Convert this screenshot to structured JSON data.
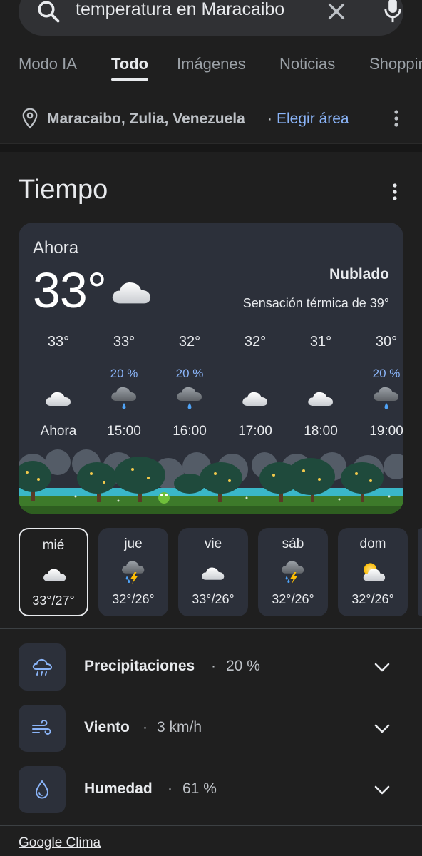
{
  "search": {
    "query": "temperatura en Maracaibo"
  },
  "tabs": [
    {
      "label": "Modo IA"
    },
    {
      "label": "Todo"
    },
    {
      "label": "Imágenes"
    },
    {
      "label": "Noticias"
    },
    {
      "label": "Shopping"
    }
  ],
  "active_tab": "Todo",
  "location": {
    "place": "Maracaibo, Zulia, Venezuela",
    "separator": "·",
    "choose_label": "Elegir área"
  },
  "weather": {
    "title": "Tiempo",
    "now": {
      "label": "Ahora",
      "temp": "33°",
      "icon": "cloudy-icon",
      "condition": "Nublado",
      "feels_like": "Sensación térmica de 39°"
    },
    "hourly": [
      {
        "temp": "33°",
        "precip": "",
        "icon": "cloudy-icon",
        "time": "Ahora"
      },
      {
        "temp": "33°",
        "precip": "20 %",
        "icon": "rain-cloud-icon",
        "time": "15:00"
      },
      {
        "temp": "32°",
        "precip": "20 %",
        "icon": "rain-cloud-icon",
        "time": "16:00"
      },
      {
        "temp": "32°",
        "precip": "",
        "icon": "cloudy-icon",
        "time": "17:00"
      },
      {
        "temp": "31°",
        "precip": "",
        "icon": "cloudy-icon",
        "time": "18:00"
      },
      {
        "temp": "30°",
        "precip": "20 %",
        "icon": "rain-cloud-icon",
        "time": "19:00"
      }
    ],
    "daily": [
      {
        "day": "mié",
        "icon": "cloudy-icon",
        "range": "33°/27°",
        "selected": true
      },
      {
        "day": "jue",
        "icon": "thunderstorm-icon",
        "range": "32°/26°"
      },
      {
        "day": "vie",
        "icon": "cloudy-icon",
        "range": "33°/26°"
      },
      {
        "day": "sáb",
        "icon": "thunderstorm-icon",
        "range": "32°/26°"
      },
      {
        "day": "dom",
        "icon": "partly-sunny-icon",
        "range": "32°/26°"
      }
    ],
    "details": [
      {
        "label": "Precipitaciones",
        "value": "20 %",
        "icon": "rain-icon"
      },
      {
        "label": "Viento",
        "value": "3 km/h",
        "icon": "wind-icon"
      },
      {
        "label": "Humedad",
        "value": "61 %",
        "icon": "humidity-icon"
      }
    ],
    "detail_separator": "·",
    "source": "Google Clima"
  },
  "colors": {
    "background": "#1f1f1f",
    "card": "#2c303a",
    "link": "#8ab4f8",
    "precip": "#8ab4f8"
  }
}
